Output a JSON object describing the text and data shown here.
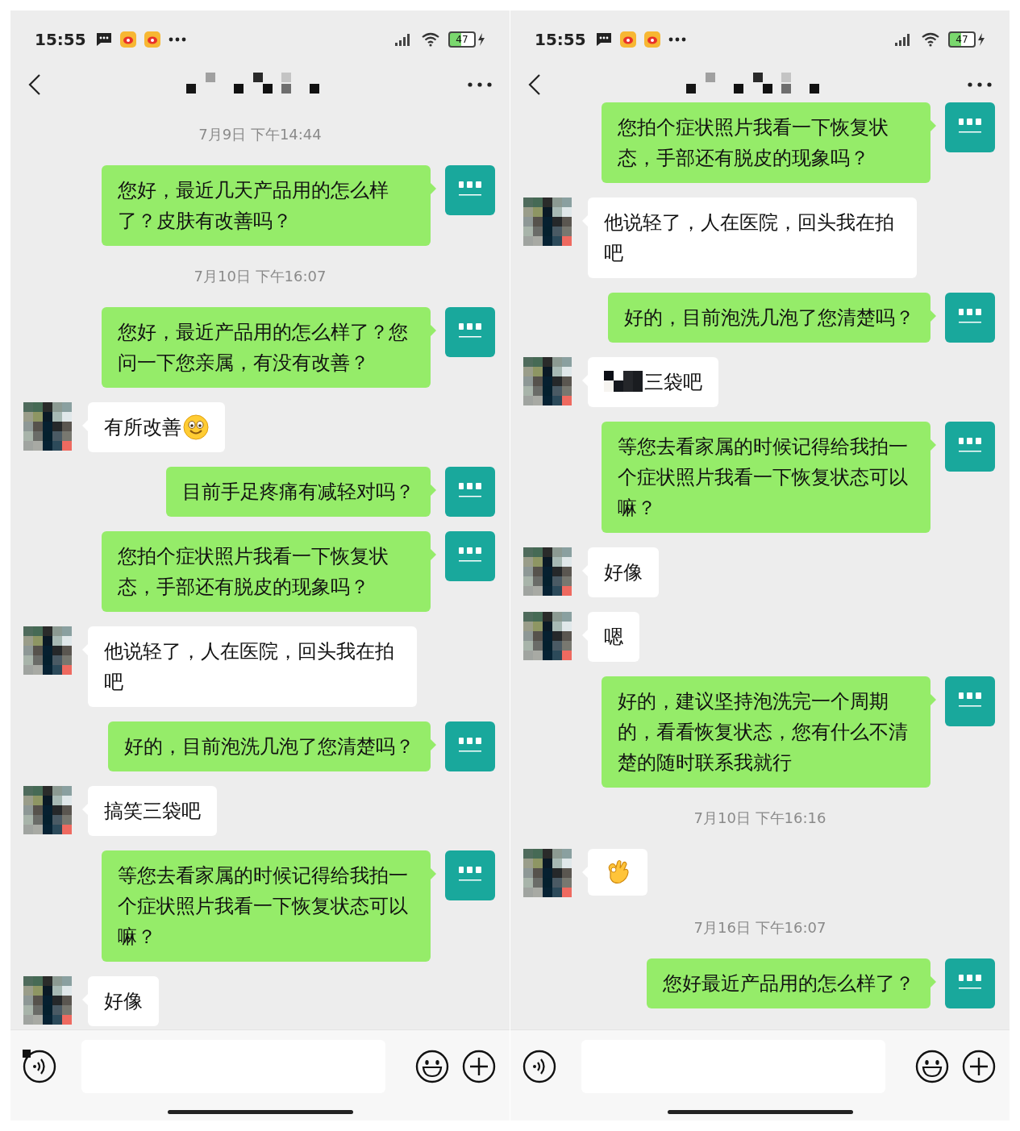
{
  "phones": [
    {
      "status_bar": {
        "time": "15:55",
        "battery": "47"
      },
      "messages": [
        {
          "kind": "time",
          "text": "7月9日 下午14:44"
        },
        {
          "kind": "outgoing",
          "text": "您好，最近几天产品用的怎么样了？皮肤有改善吗？"
        },
        {
          "kind": "time",
          "text": "7月10日 下午16:07"
        },
        {
          "kind": "outgoing",
          "text": "您好，最近产品用的怎么样了？您问一下您亲属，有没有改善？"
        },
        {
          "kind": "incoming",
          "text": "有所改善",
          "emoji": {
            "kind": "smile"
          }
        },
        {
          "kind": "outgoing",
          "text": "目前手足疼痛有减轻对吗？"
        },
        {
          "kind": "outgoing",
          "text": "您拍个症状照片我看一下恢复状态，手部还有脱皮的现象吗？"
        },
        {
          "kind": "incoming",
          "text": "他说轻了，人在医院，回头我在拍吧"
        },
        {
          "kind": "outgoing",
          "text": "好的，目前泡洗几泡了您清楚吗？"
        },
        {
          "kind": "incoming",
          "text": "搞笑三袋吧"
        },
        {
          "kind": "outgoing",
          "text": "等您去看家属的时候记得给我拍一个症状照片我看一下恢复状态可以嘛？"
        },
        {
          "kind": "incoming",
          "text": "好像"
        }
      ]
    },
    {
      "status_bar": {
        "time": "15:55",
        "battery": "47"
      },
      "messages": [
        {
          "kind": "outgoing",
          "text": "您拍个症状照片我看一下恢复状态，手部还有脱皮的现象吗？"
        },
        {
          "kind": "incoming",
          "text": "他说轻了，人在医院，回头我在拍吧"
        },
        {
          "kind": "outgoing",
          "text": "好的，目前泡洗几泡了您清楚吗？"
        },
        {
          "kind": "incoming",
          "text": "三袋吧",
          "redacted_prefix": true
        },
        {
          "kind": "outgoing",
          "text": "等您去看家属的时候记得给我拍一个症状照片我看一下恢复状态可以嘛？"
        },
        {
          "kind": "incoming",
          "text": "好像"
        },
        {
          "kind": "incoming",
          "text": "嗯"
        },
        {
          "kind": "outgoing",
          "text": "好的，建议坚持泡洗完一个周期的，看看恢复状态，您有什么不清楚的随时联系我就行"
        },
        {
          "kind": "time",
          "text": "7月10日 下午16:16"
        },
        {
          "kind": "incoming",
          "emoji": {
            "kind": "ok_hand"
          }
        },
        {
          "kind": "time",
          "text": "7月16日 下午16:07"
        },
        {
          "kind": "outgoing",
          "text": "您好最近产品用的怎么样了？"
        }
      ]
    }
  ]
}
